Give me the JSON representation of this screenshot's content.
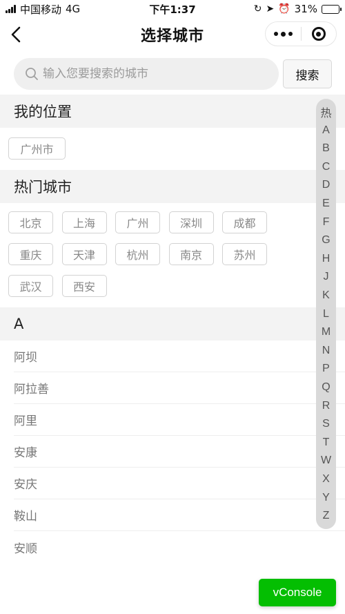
{
  "status_bar": {
    "carrier": "中国移动",
    "network": "4G",
    "time": "下午1:37",
    "battery_text": "31%",
    "battery_level": 0.31
  },
  "nav": {
    "title": "选择城市"
  },
  "search": {
    "placeholder": "输入您要搜索的城市",
    "button_label": "搜索"
  },
  "my_location": {
    "header": "我的位置",
    "city": "广州市"
  },
  "hot_cities": {
    "header": "热门城市",
    "items": [
      "北京",
      "上海",
      "广州",
      "深圳",
      "成都",
      "重庆",
      "天津",
      "杭州",
      "南京",
      "苏州",
      "武汉",
      "西安"
    ]
  },
  "group_a": {
    "header": "A",
    "items": [
      "阿坝",
      "阿拉善",
      "阿里",
      "安康",
      "安庆",
      "鞍山",
      "安顺"
    ]
  },
  "index_bar": [
    "热",
    "A",
    "B",
    "C",
    "D",
    "E",
    "F",
    "G",
    "H",
    "J",
    "K",
    "L",
    "M",
    "N",
    "P",
    "Q",
    "R",
    "S",
    "T",
    "W",
    "X",
    "Y",
    "Z"
  ],
  "vconsole_label": "vConsole",
  "icons": {
    "back": "chevron-left-icon",
    "more": "more-dots-icon",
    "close": "target-close-icon",
    "search": "search-icon"
  }
}
